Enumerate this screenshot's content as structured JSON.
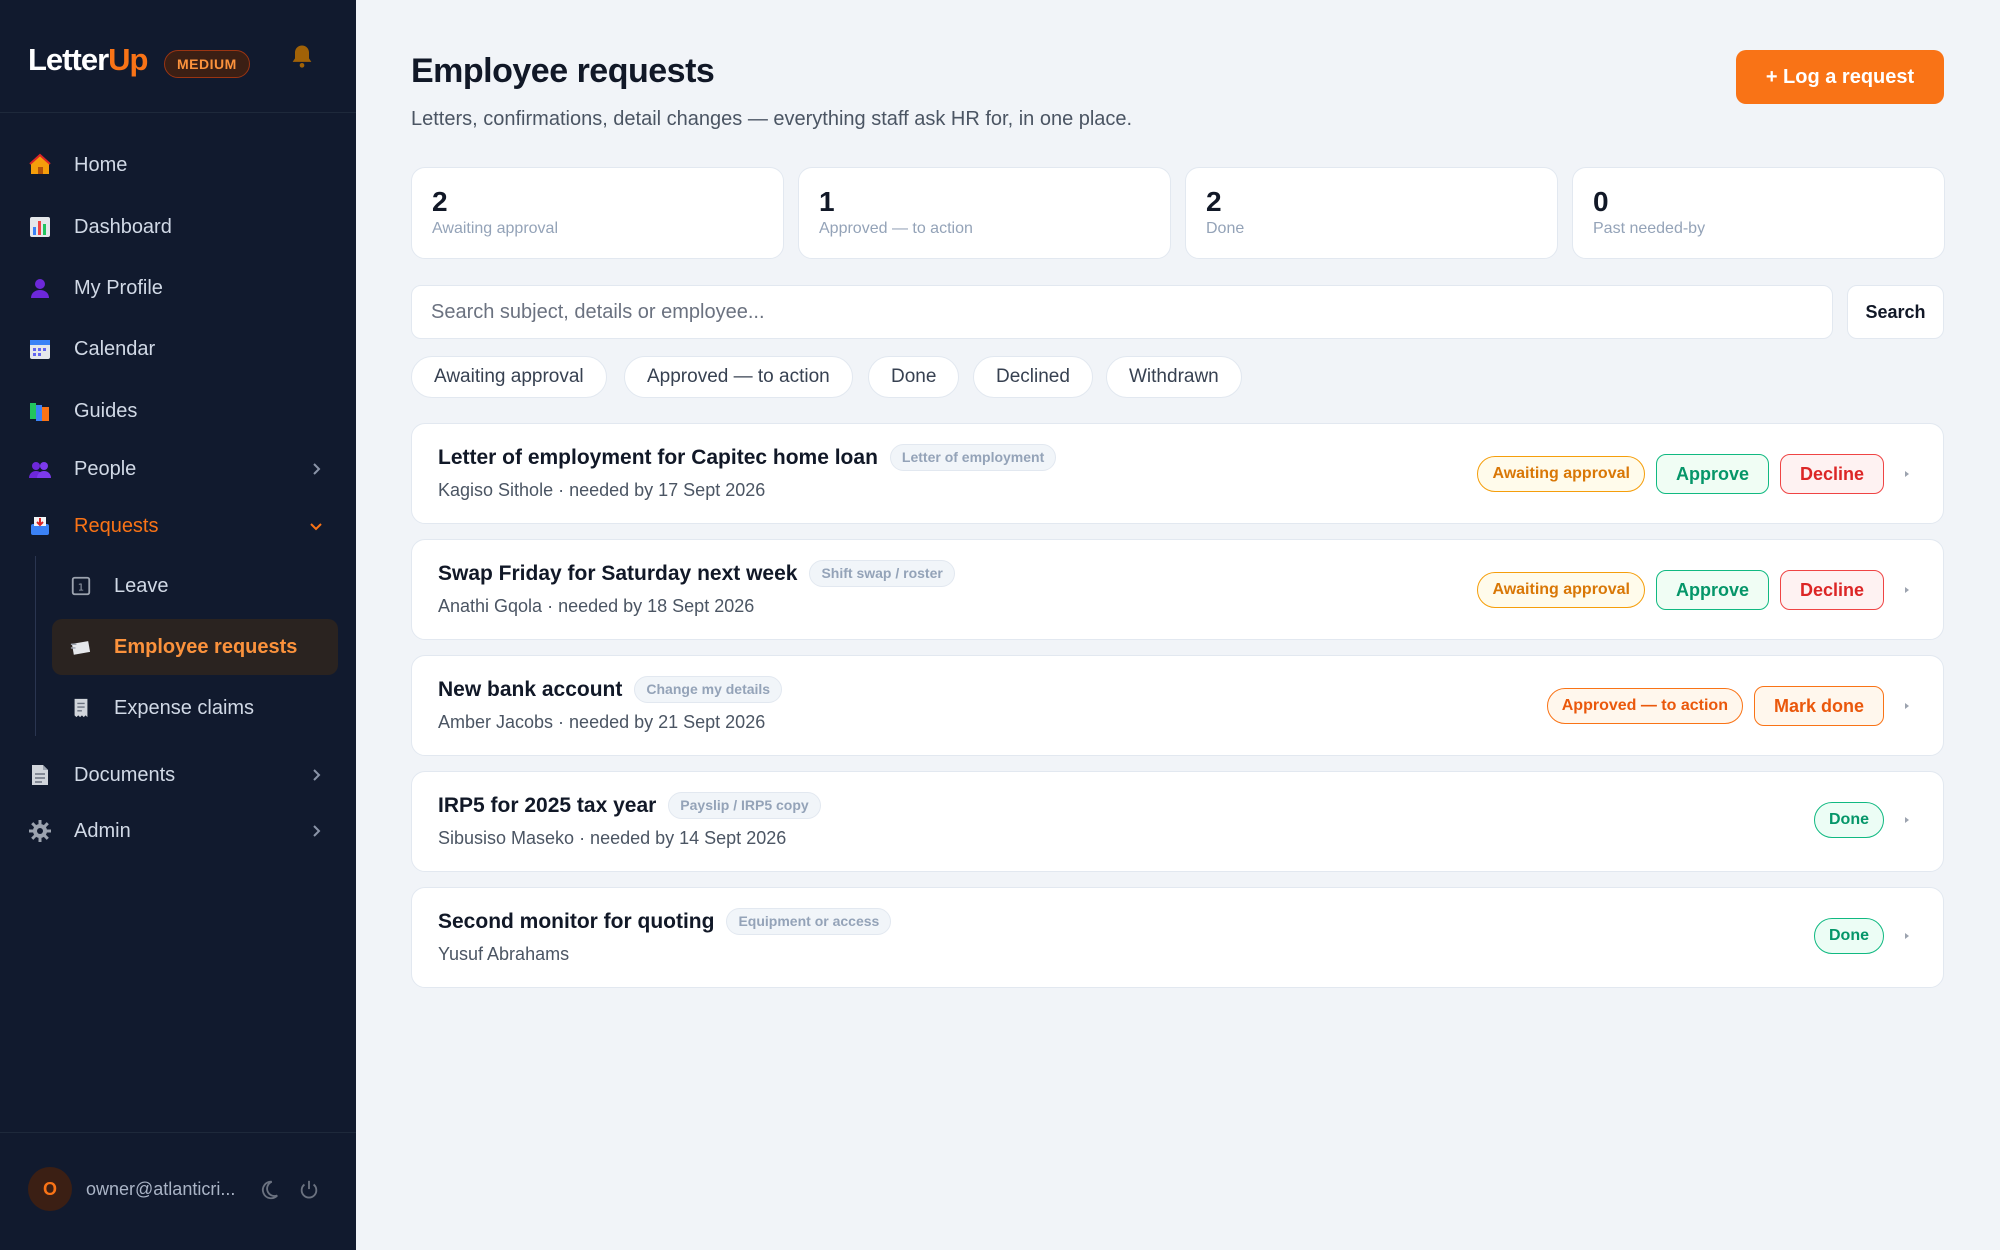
{
  "brand": {
    "name_part1": "Letter",
    "name_part2": "Up",
    "plan": "MEDIUM"
  },
  "nav": {
    "items": [
      {
        "label": "Home",
        "icon": "house-icon"
      },
      {
        "label": "Dashboard",
        "icon": "bar-chart-icon"
      },
      {
        "label": "My Profile",
        "icon": "person-icon"
      },
      {
        "label": "Calendar",
        "icon": "calendar-icon"
      },
      {
        "label": "Guides",
        "icon": "books-icon"
      },
      {
        "label": "People",
        "icon": "people-icon"
      },
      {
        "label": "Requests",
        "icon": "inbox-tray-icon"
      },
      {
        "label": "Documents",
        "icon": "document-icon"
      },
      {
        "label": "Admin",
        "icon": "gear-icon"
      }
    ],
    "requests_sub": [
      {
        "label": "Leave",
        "icon": "calendar-page-icon"
      },
      {
        "label": "Employee requests",
        "icon": "envelope-icon"
      },
      {
        "label": "Expense claims",
        "icon": "receipt-icon"
      }
    ]
  },
  "user": {
    "initial": "O",
    "email": "owner@atlanticri..."
  },
  "header": {
    "title": "Employee requests",
    "subtitle": "Letters, confirmations, detail changes — everything staff ask HR for, in one place.",
    "log_button": "+  Log a request"
  },
  "stats": [
    {
      "value": "2",
      "label": "Awaiting approval"
    },
    {
      "value": "1",
      "label": "Approved — to action"
    },
    {
      "value": "2",
      "label": "Done"
    },
    {
      "value": "0",
      "label": "Past needed-by"
    }
  ],
  "search": {
    "placeholder": "Search subject, details or employee...",
    "button": "Search"
  },
  "filters": [
    "Awaiting approval",
    "Approved — to action",
    "Done",
    "Declined",
    "Withdrawn"
  ],
  "requests": [
    {
      "title": "Letter of employment for Capitec home loan",
      "category": "Letter of employment",
      "meta": "Kagiso Sithole · needed by 17 Sept 2026",
      "status": "Awaiting approval",
      "approve": "Approve",
      "decline": "Decline"
    },
    {
      "title": "Swap Friday for Saturday next week",
      "category": "Shift swap / roster",
      "meta": "Anathi Gqola · needed by 18 Sept 2026",
      "status": "Awaiting approval",
      "approve": "Approve",
      "decline": "Decline"
    },
    {
      "title": "New bank account",
      "category": "Change my details",
      "meta": "Amber Jacobs · needed by 21 Sept 2026",
      "status": "Approved — to action",
      "mark_done": "Mark done"
    },
    {
      "title": "IRP5 for 2025 tax year",
      "category": "Payslip / IRP5 copy",
      "meta": "Sibusiso Maseko · needed by 14 Sept 2026",
      "status": "Done"
    },
    {
      "title": "Second monitor for quoting",
      "category": "Equipment or access",
      "meta": "Yusuf Abrahams",
      "status": "Done"
    }
  ],
  "colors": {
    "accent": "#f97316",
    "sidebar": "#111a2e",
    "success": "#10b981",
    "danger": "#ef4444",
    "warning": "#f59e0b"
  }
}
